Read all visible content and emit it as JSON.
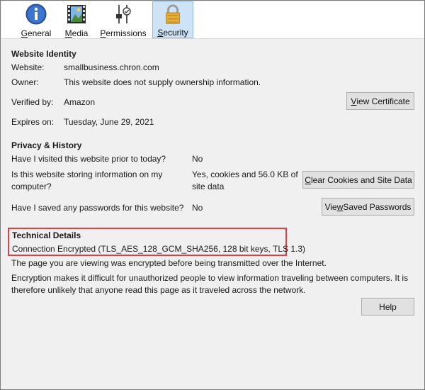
{
  "tabs": [
    {
      "id": "general",
      "label_pre": "",
      "label_u": "G",
      "label_post": "eneral",
      "icon": "info-icon",
      "selected": false
    },
    {
      "id": "media",
      "label_pre": "",
      "label_u": "M",
      "label_post": "edia",
      "icon": "film-image-icon",
      "selected": false
    },
    {
      "id": "permissions",
      "label_pre": "",
      "label_u": "P",
      "label_post": "ermissions",
      "icon": "permissions-sliders-icon",
      "selected": false
    },
    {
      "id": "security",
      "label_pre": "",
      "label_u": "S",
      "label_post": "ecurity",
      "icon": "padlock-icon",
      "selected": true
    }
  ],
  "identity": {
    "title": "Website Identity",
    "website_label": "Website:",
    "website_value": "smallbusiness.chron.com",
    "owner_label": "Owner:",
    "owner_value": "This website does not supply ownership information.",
    "verified_label": "Verified by:",
    "verified_value": "Amazon",
    "expires_label": "Expires on:",
    "expires_value": "Tuesday, June 29, 2021",
    "view_cert_pre": "",
    "view_cert_u": "V",
    "view_cert_post": "iew Certificate"
  },
  "privacy": {
    "title": "Privacy & History",
    "q1": "Have I visited this website prior to today?",
    "a1": "No",
    "q2": "Is this website storing information on my computer?",
    "a2": "Yes, cookies and 56.0 KB of site data",
    "clear_pre": "",
    "clear_u": "C",
    "clear_post": "lear Cookies and Site Data",
    "q3": "Have I saved any passwords for this website?",
    "a3": "No",
    "view_pw_pre": "Vie",
    "view_pw_u": "w",
    "view_pw_post": " Saved Passwords"
  },
  "technical": {
    "title": "Technical Details",
    "connection": "Connection Encrypted (TLS_AES_128_GCM_SHA256, 128 bit keys, TLS 1.3)",
    "line1": "The page you are viewing was encrypted before being transmitted over the Internet.",
    "line2": "Encryption makes it difficult for unauthorized people to view information traveling between computers. It is therefore unlikely that anyone read this page as it traveled across the network."
  },
  "help_label": "Help",
  "colors": {
    "highlight": "#e0403f",
    "selected_tab": "#cfe3f7"
  }
}
